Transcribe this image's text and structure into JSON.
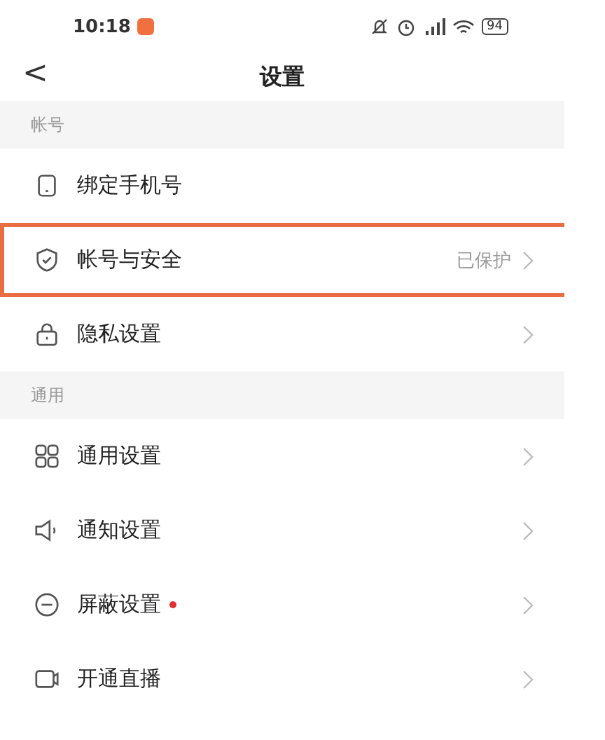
{
  "status_bar": {
    "time": "10:18",
    "battery": "94"
  },
  "header": {
    "back": "<",
    "title": "设置"
  },
  "sections": [
    {
      "title": "帐号",
      "items": [
        {
          "kind": "phone",
          "label": "绑定手机号",
          "chevron": false,
          "highlighted": false,
          "badge": false
        },
        {
          "kind": "shield",
          "label": "帐号与安全",
          "value": "已保护",
          "chevron": true,
          "highlighted": true,
          "badge": false
        },
        {
          "kind": "lock",
          "label": "隐私设置",
          "chevron": true,
          "highlighted": false,
          "badge": false
        }
      ]
    },
    {
      "title": "通用",
      "items": [
        {
          "kind": "grid",
          "label": "通用设置",
          "chevron": true,
          "highlighted": false,
          "badge": false
        },
        {
          "kind": "speaker",
          "label": "通知设置",
          "chevron": true,
          "highlighted": false,
          "badge": false
        },
        {
          "kind": "block",
          "label": "屏蔽设置",
          "chevron": true,
          "highlighted": false,
          "badge": true
        },
        {
          "kind": "live",
          "label": "开通直播",
          "chevron": true,
          "highlighted": false,
          "badge": false
        }
      ]
    }
  ]
}
